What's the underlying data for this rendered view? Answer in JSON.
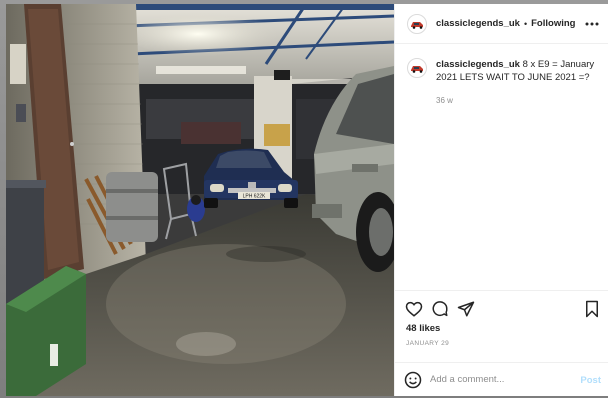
{
  "colors": {
    "accent": "#0095f6",
    "post_disabled": "#b2dffc",
    "muted": "#8e8e8e",
    "text": "#262626"
  },
  "post": {
    "image_alt": "Garage interior with classic BMW cars",
    "plate_text": "LPH 622K"
  },
  "header": {
    "username": "classiclegends_uk",
    "separator": "•",
    "follow_label": "Following",
    "more_icon": "ellipsis-icon"
  },
  "caption": {
    "username": "classiclegends_uk",
    "text": "8 x E9 = January 2021 LETS WAIT TO JUNE 2021 =?",
    "timestamp": "36 w"
  },
  "actions": {
    "like_icon": "heart-icon",
    "comment_icon": "speech-bubble-icon",
    "share_icon": "paper-plane-icon",
    "save_icon": "bookmark-icon"
  },
  "stats": {
    "likes": "48 likes",
    "date": "JANUARY 29"
  },
  "comment_box": {
    "placeholder": "Add a comment...",
    "post_label": "Post",
    "emoji_icon": "smiley-icon"
  }
}
